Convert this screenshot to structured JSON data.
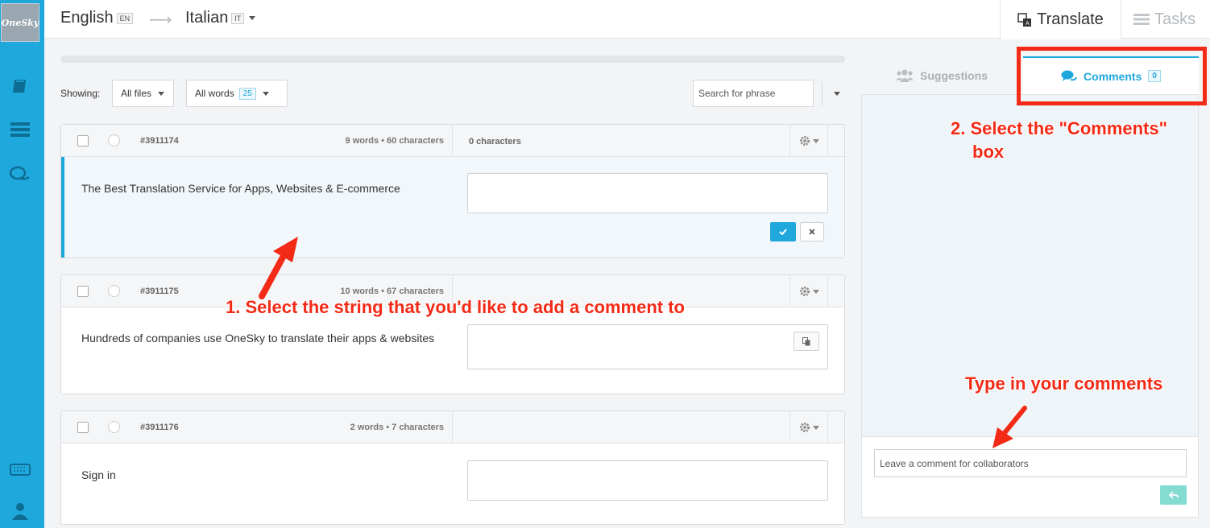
{
  "rail": {
    "logo_text": "OneSky"
  },
  "topbar": {
    "source_lang": "English",
    "source_code": "EN",
    "target_lang": "Italian",
    "target_code": "IT",
    "tab_translate": "Translate",
    "tab_tasks": "Tasks"
  },
  "filters": {
    "showing_label": "Showing:",
    "files_label": "All files",
    "words_label": "All words",
    "words_count": "25",
    "search_placeholder": "Search for phrase"
  },
  "strings": [
    {
      "id": "#3911174",
      "meta": "9 words • 60 characters",
      "translation_chars": "0 characters",
      "source": "The Best Translation Service for Apps, Websites & E-commerce"
    },
    {
      "id": "#3911175",
      "meta": "10 words • 67 characters",
      "translation_chars": "",
      "source": "Hundreds of companies use OneSky to translate their apps & websites"
    },
    {
      "id": "#3911176",
      "meta": "2 words • 7 characters",
      "translation_chars": "",
      "source": "Sign in"
    }
  ],
  "right_panel": {
    "tab_suggestions": "Suggestions",
    "tab_comments": "Comments",
    "comments_count": "0",
    "comment_placeholder": "Leave a comment for collaborators"
  },
  "annotations": {
    "step1": "1. Select the string that you'd like to add a comment to",
    "step2_line1": "2. Select the \"Comments\"",
    "step2_line2": "box",
    "step3": "Type in your comments"
  },
  "colors": {
    "brand": "#1fa8dc",
    "annotation": "#f22a16",
    "send_button": "#84dbd0"
  }
}
